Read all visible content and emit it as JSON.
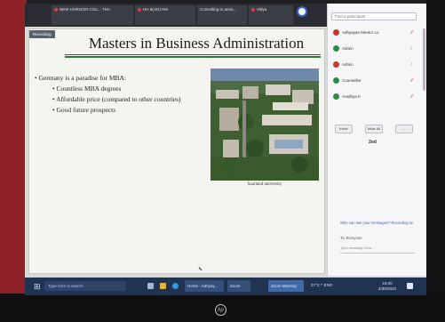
{
  "meeting": {
    "tiles": [
      {
        "label": "NEW HORIZON COL...  TNA"
      },
      {
        "label": "HH 5(UG) Rie"
      },
      {
        "label": "Consulting to anna..."
      },
      {
        "label": "Vidya"
      }
    ],
    "top_label": "Vidya"
  },
  "slide": {
    "recording_badge": "Recording",
    "title": "Masters in Business Administration",
    "bullets": [
      {
        "text": "Germany is a paradise for MBA:",
        "level": 1
      },
      {
        "text": "Countless MBA degrees",
        "level": 2
      },
      {
        "text": "Affordable price (compared to other countries)",
        "level": 2
      },
      {
        "text": "Good future prospects",
        "level": 2
      }
    ],
    "photo_caption": "Saarland university"
  },
  "participants_panel": {
    "search_placeholder": "Find a participant",
    "participants": [
      {
        "name": "Adhyayan Mentor Lo",
        "avatar_color": "#c0392b"
      },
      {
        "name": "Admin",
        "avatar_color": "#2c8a4a"
      },
      {
        "name": "Admin",
        "avatar_color": "#c0392b"
      },
      {
        "name": "Counsellor",
        "avatar_color": "#2c8a4a"
      },
      {
        "name": "Aradhya K",
        "avatar_color": "#2c8a4a"
      }
    ],
    "buttons": [
      "Invite",
      "Mute All",
      "..."
    ],
    "count_label": "2nd",
    "chat_line": "Who can see your messages? Recording on",
    "chat_to": "To:  Everyone",
    "chat_input_placeholder": "Type message here..."
  },
  "taskbar": {
    "search_placeholder": "Type here to search",
    "apps": [
      {
        "label": "Home - Adhyay...",
        "color": "#d64545"
      },
      {
        "label": "Zoom",
        "color": "#2f7bd6"
      },
      {
        "label": "Zoom Meeting",
        "color": "#2f7bd6"
      }
    ],
    "tray_text": "27°C  ^  ENG",
    "clock_time": "15:20",
    "clock_date": "4/30/2022"
  },
  "colors": {
    "bezel_red": "#8e2228",
    "taskbar": "#203350",
    "title_rule_green": "#2f7a3c"
  }
}
